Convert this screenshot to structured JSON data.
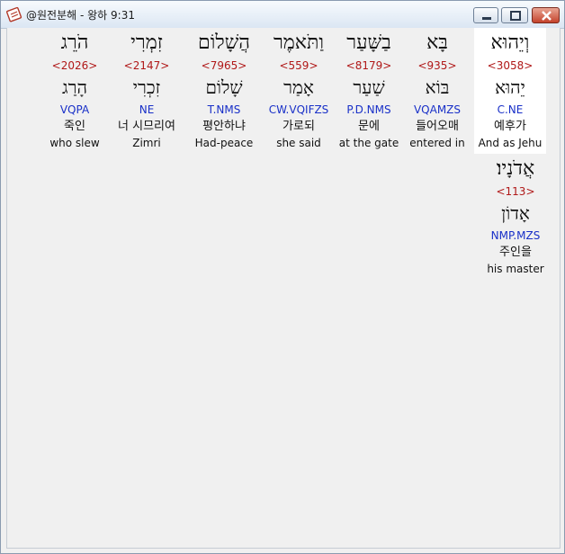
{
  "window": {
    "title": "@원전분해 - 왕하 9:31"
  },
  "icons": {
    "app": "bible-app-icon",
    "minimize": "minimize-icon",
    "maximize": "maximize-icon",
    "close": "close-icon"
  },
  "colors": {
    "strong": "#b01818",
    "morph": "#1930c8",
    "selected_bg": "#ffffff"
  },
  "row1": [
    {
      "hebrew": "וְיֵהוּא",
      "strong": "<3058>",
      "lemma": "יֵהוּא",
      "morph": "C.NE",
      "korean": "예후가",
      "english": "And as Jehu",
      "selected": true
    },
    {
      "hebrew": "בָּא",
      "strong": "<935>",
      "lemma": "בּוֹא",
      "morph": "VQAMZS",
      "korean": "들어오매",
      "english": "entered in"
    },
    {
      "hebrew": "בַשָּׁעַר",
      "strong": "<8179>",
      "lemma": "שַׁעַר",
      "morph": "P.D.NMS",
      "korean": "문에",
      "english": "at the gate"
    },
    {
      "hebrew": "וַתֹּאמֶר",
      "strong": "<559>",
      "lemma": "אָמַר",
      "morph": "CW.VQIFZS",
      "korean": "가로되",
      "english": "she said"
    },
    {
      "hebrew": "הֲשָׁלוֹם",
      "strong": "<7965>",
      "lemma": "שָׁלוֹם",
      "morph": "T.NMS",
      "korean": "평안하냐",
      "english": "Had-peace"
    },
    {
      "hebrew": "זִמְרִי",
      "strong": "<2147>",
      "lemma": "זִכְרִי",
      "morph": "NE",
      "korean": "너 시므리여",
      "english": "Zimri"
    },
    {
      "hebrew": "הֹרֵג",
      "strong": "<2026>",
      "lemma": "הָרַג",
      "morph": "VQPA",
      "korean": "죽인",
      "english": "who slew"
    }
  ],
  "row2": [
    {
      "hebrew": "אֲדֹנָיו׃",
      "strong": "<113>",
      "lemma": "אָדוֹן",
      "morph": "NMP.MZS",
      "korean": "주인을",
      "english": "his master"
    }
  ]
}
